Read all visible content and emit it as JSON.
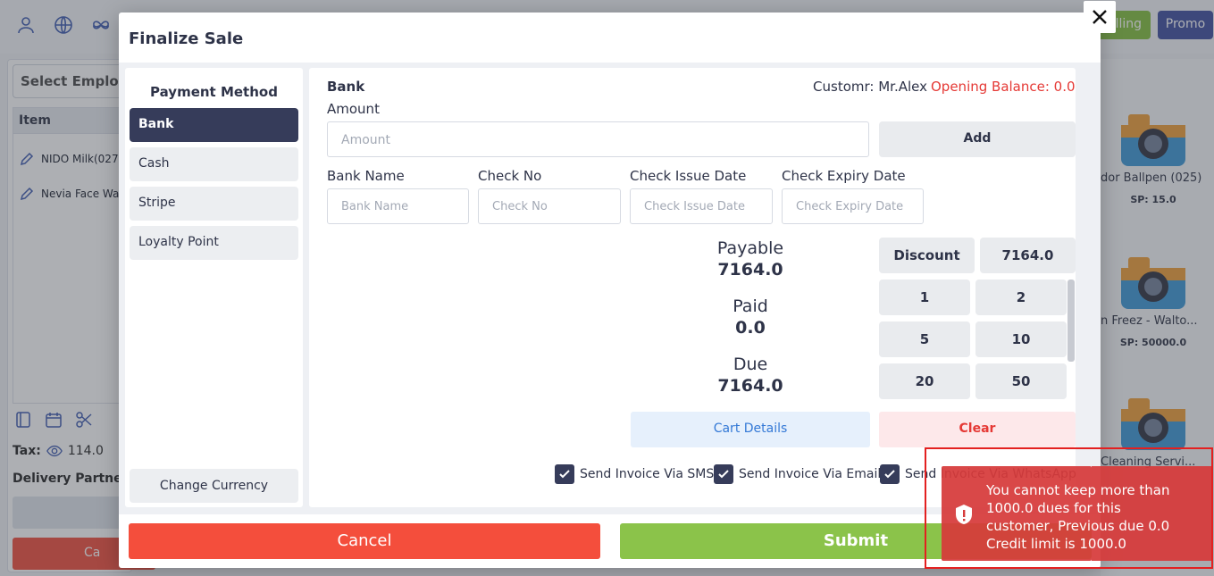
{
  "background": {
    "select_employee": "Select Employee",
    "table_header": "Item",
    "items": [
      "NIDO Milk(027",
      "Nevia Face Wa"
    ],
    "tax_label": "Tax:",
    "tax_value": "114.0",
    "delivery_label": "Delivery Partner:",
    "cancel_label": "Ca",
    "billing_label": "lling",
    "promo_label": "Promo",
    "products": [
      {
        "name": "dor Ballpen (025)",
        "sp": "SP: 15.0"
      },
      {
        "name": "n Freez - Walto...",
        "sp": "SP: 50000.0"
      },
      {
        "name": "Cleaning Servi...",
        "sp": ""
      }
    ]
  },
  "modal": {
    "title": "Finalize Sale",
    "payment_method_title": "Payment Method",
    "payment_methods": [
      "Bank",
      "Cash",
      "Stripe",
      "Loyalty Point"
    ],
    "selected_method": "Bank",
    "change_currency": "Change Currency",
    "section_title": "Bank",
    "customer": "Customr: Mr.Alex",
    "opening_balance": "Opening Balance: 0.0",
    "amount_label": "Amount",
    "amount_placeholder": "Amount",
    "add_label": "Add",
    "fields": [
      {
        "label": "Bank Name",
        "placeholder": "Bank Name"
      },
      {
        "label": "Check No",
        "placeholder": "Check No"
      },
      {
        "label": "Check Issue Date",
        "placeholder": "Check Issue Date"
      },
      {
        "label": "Check Expiry Date",
        "placeholder": "Check Expiry Date"
      }
    ],
    "payable_label": "Payable",
    "payable_value": "7164.0",
    "paid_label": "Paid",
    "paid_value": "0.0",
    "due_label": "Due",
    "due_value": "7164.0",
    "discount_label": "Discount",
    "discount_value": "7164.0",
    "keypad": [
      "1",
      "2",
      "5",
      "10",
      "20",
      "50"
    ],
    "cart_details": "Cart Details",
    "clear": "Clear",
    "send_sms": "Send Invoice Via SMS",
    "send_email": "Send Invoice Via Email",
    "send_whatsapp": "Send Invoice Via WhatsApp",
    "cancel": "Cancel",
    "submit": "Submit"
  },
  "toast": {
    "message": "You cannot keep more than 1000.0 dues for this customer, Previous due 0.0 Credit limit is 1000.0",
    "icon": "shield-alert-icon"
  },
  "colors": {
    "accent_dark": "#363c5a",
    "cancel_red": "#f44e3c",
    "submit_green": "#8bc34a",
    "error_red": "#e53935",
    "link_blue": "#3479d6"
  }
}
